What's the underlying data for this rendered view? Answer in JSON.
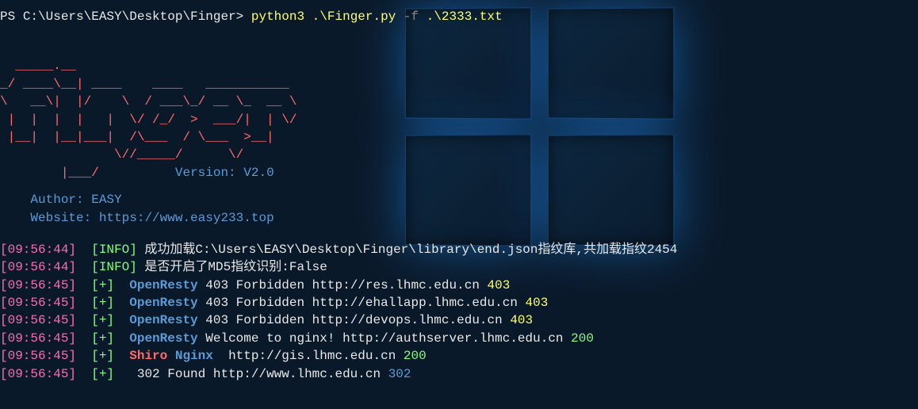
{
  "prompt": {
    "ps": "PS ",
    "path": "C:\\Users\\EASY\\Desktop\\Finger> ",
    "cmd1": "python3",
    "arg1": " .\\Finger.py ",
    "flag": "-f",
    "arg2": " .\\2333.txt"
  },
  "ascii": {
    "l1": "  _____.__",
    "l2": "_/ ____\\__| ____    ____   ___________",
    "l3": "\\   __\\|  |/    \\  / ___\\_/ __ \\_  __ \\",
    "l4": " |  |  |  |   |  \\/ /_/  >  ___/|  | \\/",
    "l5": " |__|  |__|___|  /\\___  / \\___  >__|",
    "l6": "               \\//_____/      \\/",
    "version_indent": "        |___/          ",
    "version": "Version: V2.0"
  },
  "meta": {
    "author_indent": "    ",
    "author": "Author: EASY",
    "website_indent": "    ",
    "website_label": "Website: ",
    "website_url": "https://www.easy233.top"
  },
  "logs": [
    {
      "ts": "[09:56:44]",
      "tag": "[INFO]",
      "type": "info",
      "rest": " 成功加载C:\\Users\\EASY\\Desktop\\Finger\\library\\end.json指纹库,共加载指纹2454"
    },
    {
      "ts": "[09:56:44]",
      "tag": "[INFO]",
      "type": "info",
      "rest": " 是否开启了MD5指纹识别:False"
    },
    {
      "ts": "[09:56:45]",
      "tag": "[+]",
      "type": "plus",
      "engine": "OpenResty",
      "mid": " 403 Forbidden http://res.lhmc.edu.cn ",
      "status": "403",
      "statusClass": "403"
    },
    {
      "ts": "[09:56:45]",
      "tag": "[+]",
      "type": "plus",
      "engine": "OpenResty",
      "mid": " 403 Forbidden http://ehallapp.lhmc.edu.cn ",
      "status": "403",
      "statusClass": "403"
    },
    {
      "ts": "[09:56:45]",
      "tag": "[+]",
      "type": "plus",
      "engine": "OpenResty",
      "mid": " 403 Forbidden http://devops.lhmc.edu.cn ",
      "status": "403",
      "statusClass": "403"
    },
    {
      "ts": "[09:56:45]",
      "tag": "[+]",
      "type": "plus",
      "engine": "OpenResty",
      "mid": " Welcome to nginx! http://authserver.lhmc.edu.cn ",
      "status": "200",
      "statusClass": "200"
    },
    {
      "ts": "[09:56:45]",
      "tag": "[+]",
      "type": "plus",
      "engine": "Shiro",
      "engine2": "Nginx",
      "mid": "  http://gis.lhmc.edu.cn ",
      "status": "200",
      "statusClass": "200"
    },
    {
      "ts": "[09:56:45]",
      "tag": "[+]",
      "type": "plus",
      "mid": "   302 Found http://www.lhmc.edu.cn ",
      "status": "302",
      "statusClass": "302"
    }
  ]
}
